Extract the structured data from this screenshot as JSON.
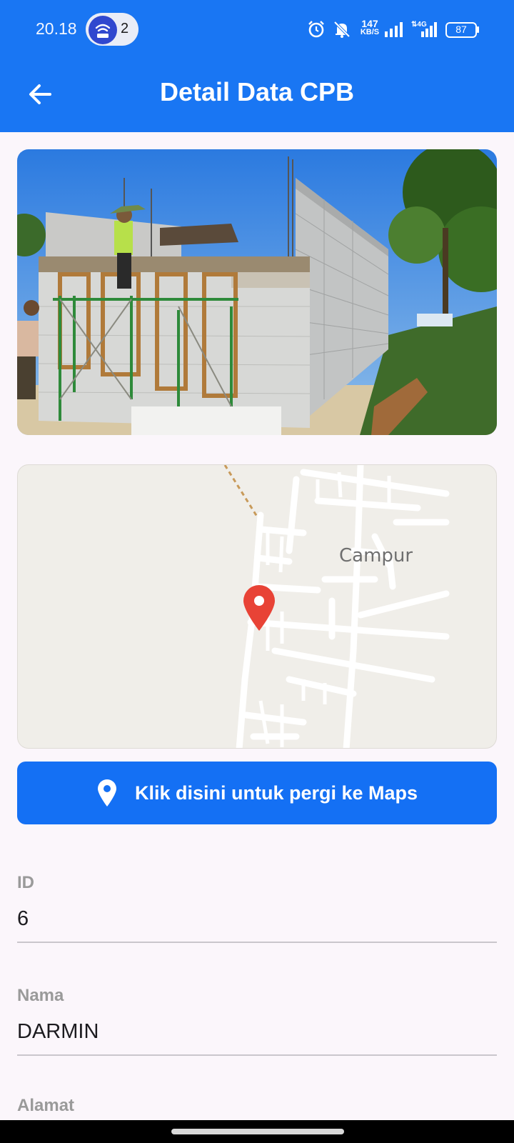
{
  "status_bar": {
    "time": "20.18",
    "hotspot_count": "2",
    "net_speed_value": "147",
    "net_speed_unit": "KB/S",
    "network_type": "4G",
    "battery": "87",
    "icons": [
      "hotspot-icon",
      "alarm-icon",
      "bell-off-icon",
      "signal-icon",
      "signal-4g-icon",
      "battery-icon"
    ]
  },
  "app_bar": {
    "title": "Detail Data CPB",
    "back_icon": "arrow-left-icon"
  },
  "photo": {
    "description_icon": "house-construction-photo"
  },
  "map": {
    "place_label": "Campur",
    "marker_icon": "map-pin-icon"
  },
  "maps_button": {
    "label": "Klik disini untuk pergi ke Maps",
    "icon": "location-pin-icon"
  },
  "fields": [
    {
      "label": "ID",
      "value": "6"
    },
    {
      "label": "Nama",
      "value": "DARMIN"
    },
    {
      "label": "Alamat",
      "value": ""
    }
  ],
  "colors": {
    "primary": "#1976f3",
    "button": "#1470f4",
    "background": "#fbf6fb",
    "pin": "#e84336",
    "label": "#9a9a9a"
  }
}
